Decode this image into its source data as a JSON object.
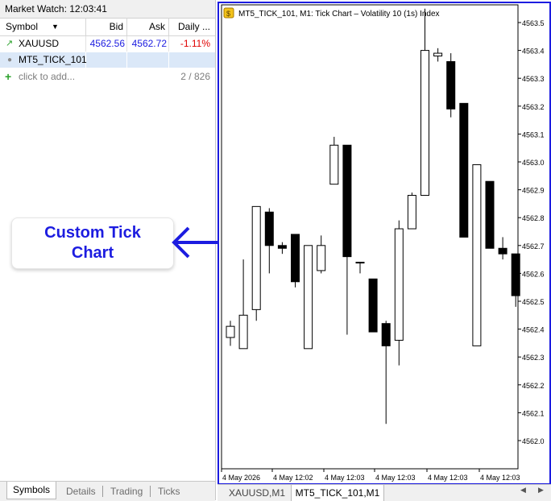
{
  "market_watch": {
    "title": "Market Watch: 12:03:41",
    "columns": [
      "Symbol",
      "Bid",
      "Ask",
      "Daily ..."
    ],
    "rows": [
      {
        "symbol": "XAUUSD",
        "bid": "4562.56",
        "ask": "4562.72",
        "daily": "-1.11%"
      },
      {
        "symbol": "MT5_TICK_101",
        "bid": "",
        "ask": "",
        "daily": ""
      }
    ],
    "add_placeholder": "click to add...",
    "count": "2 / 826",
    "tabs": [
      "Symbols",
      "Details",
      "Trading",
      "Ticks"
    ]
  },
  "callout": {
    "line1": "Custom Tick",
    "line2": "Chart"
  },
  "chart": {
    "title": "MT5_TICK_101, M1:  Tick Chart – Volatility 10 (1s) Index",
    "price_labels": [
      "4563.5",
      "4563.4",
      "4563.3",
      "4563.2",
      "4563.1",
      "4563.0",
      "4562.9",
      "4562.8",
      "4562.7",
      "4562.6",
      "4562.5",
      "4562.4",
      "4562.3",
      "4562.2",
      "4562.1",
      "4562.0"
    ],
    "time_labels": [
      "4 May 2026",
      "4 May 12:02",
      "4 May 12:03",
      "4 May 12:03",
      "4 May 12:03",
      "4 May 12:03"
    ]
  },
  "chart_data": {
    "type": "candlestick",
    "candles": [
      {
        "o": 4562.37,
        "h": 4562.43,
        "l": 4562.34,
        "c": 4562.41
      },
      {
        "o": 4562.33,
        "h": 4562.65,
        "l": 4562.33,
        "c": 4562.45
      },
      {
        "o": 4562.47,
        "h": 4562.72,
        "l": 4562.43,
        "c": 4562.84
      },
      {
        "o": 4562.82,
        "h": 4562.834,
        "l": 4562.6,
        "c": 4562.7
      },
      {
        "o": 4562.7,
        "h": 4562.712,
        "l": 4562.67,
        "c": 4562.69
      },
      {
        "o": 4562.74,
        "h": 4562.74,
        "l": 4562.55,
        "c": 4562.57
      },
      {
        "o": 4562.33,
        "h": 4562.3,
        "l": 4562.33,
        "c": 4562.7
      },
      {
        "o": 4562.61,
        "h": 4562.736,
        "l": 4562.6,
        "c": 4562.7
      },
      {
        "o": 4562.92,
        "h": 4563.09,
        "l": 4562.92,
        "c": 4563.06
      },
      {
        "o": 4563.06,
        "h": 4563.06,
        "l": 4562.38,
        "c": 4562.66
      },
      {
        "o": 4562.64,
        "h": 4562.63,
        "l": 4562.6,
        "c": 4562.64
      },
      {
        "o": 4562.58,
        "h": 4562.58,
        "l": 4562.39,
        "c": 4562.39
      },
      {
        "o": 4562.42,
        "h": 4562.43,
        "l": 4562.06,
        "c": 4562.34
      },
      {
        "o": 4562.36,
        "h": 4562.79,
        "l": 4562.27,
        "c": 4562.76
      },
      {
        "o": 4562.76,
        "h": 4562.89,
        "l": 4562.76,
        "c": 4562.88
      },
      {
        "o": 4562.88,
        "h": 4563.55,
        "l": 4562.88,
        "c": 4563.4
      },
      {
        "o": 4563.38,
        "h": 4563.408,
        "l": 4563.36,
        "c": 4563.39
      },
      {
        "o": 4563.36,
        "h": 4563.39,
        "l": 4563.16,
        "c": 4563.19
      },
      {
        "o": 4563.21,
        "h": 4563.17,
        "l": 4562.73,
        "c": 4562.73
      },
      {
        "o": 4562.34,
        "h": 4562.99,
        "l": 4562.34,
        "c": 4562.99
      },
      {
        "o": 4562.93,
        "h": 4562.93,
        "l": 4562.69,
        "c": 4562.69
      },
      {
        "o": 4562.69,
        "h": 4562.73,
        "l": 4562.65,
        "c": 4562.67
      },
      {
        "o": 4562.67,
        "h": 4562.67,
        "l": 4562.48,
        "c": 4562.52
      }
    ]
  },
  "bottom_tabs": [
    "XAUUSD,M1",
    "MT5_TICK_101,M1"
  ],
  "colors": {
    "accent": "#1c1ce0",
    "bid_ask": "#1c1ce0",
    "negative": "#e00000"
  }
}
